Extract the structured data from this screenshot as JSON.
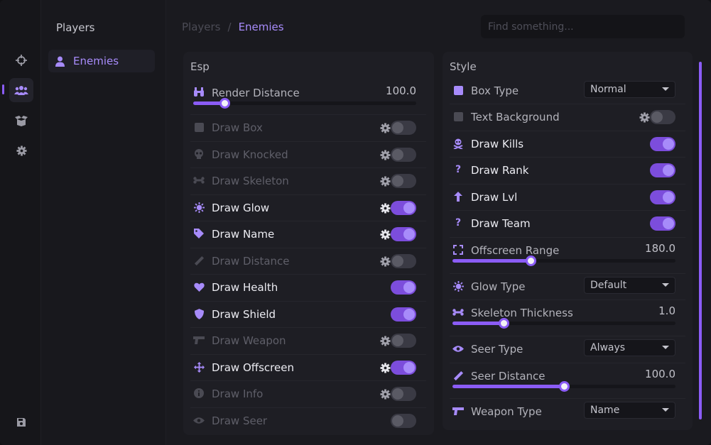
{
  "nav": {
    "section_title": "Players",
    "item_label": "Enemies"
  },
  "breadcrumb": {
    "parent": "Players",
    "separator": "/",
    "current": "Enemies"
  },
  "search": {
    "placeholder": "Find something..."
  },
  "esp": {
    "title": "Esp",
    "render_distance": {
      "label": "Render Distance",
      "value": "100.0",
      "fraction": 0.14
    },
    "rows": [
      {
        "label": "Draw Box",
        "icon": "square-icon",
        "gear": true,
        "enabled": false
      },
      {
        "label": "Draw Knocked",
        "icon": "skull-icon",
        "gear": true,
        "enabled": false
      },
      {
        "label": "Draw Skeleton",
        "icon": "bone-icon",
        "gear": true,
        "enabled": false
      },
      {
        "label": "Draw Glow",
        "icon": "sun-icon",
        "gear": true,
        "enabled": true
      },
      {
        "label": "Draw Name",
        "icon": "tag-icon",
        "gear": true,
        "enabled": true
      },
      {
        "label": "Draw Distance",
        "icon": "ruler-icon",
        "gear": true,
        "enabled": false
      },
      {
        "label": "Draw Health",
        "icon": "heart-icon",
        "gear": false,
        "enabled": true
      },
      {
        "label": "Draw Shield",
        "icon": "shield-icon",
        "gear": false,
        "enabled": true
      },
      {
        "label": "Draw Weapon",
        "icon": "gun-icon",
        "gear": true,
        "enabled": false
      },
      {
        "label": "Draw Offscreen",
        "icon": "move-arrows-icon",
        "gear": true,
        "enabled": true
      },
      {
        "label": "Draw Info",
        "icon": "info-icon",
        "gear": true,
        "enabled": false
      },
      {
        "label": "Draw Seer",
        "icon": "eye-icon",
        "gear": false,
        "enabled": false
      }
    ]
  },
  "style": {
    "title": "Style",
    "box_type": {
      "label": "Box Type",
      "value": "Normal"
    },
    "text_background": {
      "label": "Text Background",
      "enabled": false
    },
    "draw_kills": {
      "label": "Draw Kills",
      "enabled": true
    },
    "draw_rank": {
      "label": "Draw Rank",
      "enabled": true
    },
    "draw_lvl": {
      "label": "Draw Lvl",
      "enabled": true
    },
    "draw_team": {
      "label": "Draw Team",
      "enabled": true
    },
    "offscreen_range": {
      "label": "Offscreen Range",
      "value": "180.0",
      "fraction": 0.35
    },
    "glow_type": {
      "label": "Glow Type",
      "value": "Default"
    },
    "skeleton_thickness": {
      "label": "Skeleton Thickness",
      "value": "1.0",
      "fraction": 0.23
    },
    "seer_type": {
      "label": "Seer Type",
      "value": "Always"
    },
    "seer_distance": {
      "label": "Seer Distance",
      "value": "100.0",
      "fraction": 0.5
    },
    "weapon_type": {
      "label": "Weapon Type",
      "value": "Name"
    },
    "question_glyph": "?"
  },
  "colors": {
    "accent": "#8b5cf6",
    "accent_light": "#a78bfa",
    "panel": "#1e1e24",
    "background": "#1a1a1f"
  }
}
